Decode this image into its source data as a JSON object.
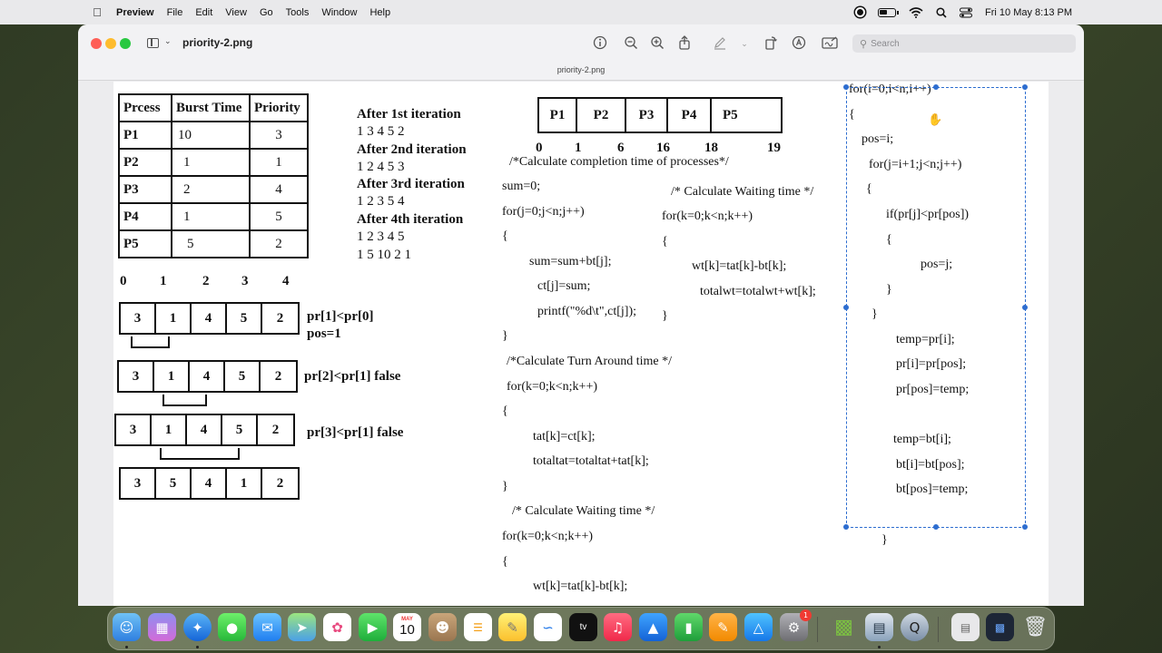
{
  "menubar": {
    "app_name": "Preview",
    "items": [
      "File",
      "Edit",
      "View",
      "Go",
      "Tools",
      "Window",
      "Help"
    ],
    "datetime": "Fri 10 May  8:13 PM"
  },
  "window": {
    "file_name": "priority-2.png",
    "subtitle": "priority-2.png",
    "search_placeholder": "Search"
  },
  "doc": {
    "table": {
      "headers": [
        "Prcess",
        "Burst Time",
        "Priority"
      ],
      "rows": [
        [
          "P1",
          "10",
          "3"
        ],
        [
          "P2",
          "1",
          "1"
        ],
        [
          "P3",
          "2",
          "4"
        ],
        [
          "P4",
          "1",
          "5"
        ],
        [
          "P5",
          "5",
          "2"
        ]
      ]
    },
    "iterations": [
      {
        "title": "After  1st iteration",
        "values": "1    3    4    5    2"
      },
      {
        "title": "After 2nd iteration",
        "values": "1    2    4    5    3"
      },
      {
        "title": "After 3rd iteration",
        "values": "1    2     3    5    4"
      },
      {
        "title": "After 4th iteration",
        "values": "1    2    3    4     5"
      }
    ],
    "iteration_final": "1    5    10   2    1",
    "gantt": {
      "cells": [
        "P1",
        "P2",
        "P3",
        "P4",
        "P5"
      ],
      "times": [
        "0",
        "1",
        "6",
        "16",
        "18",
        "19"
      ]
    },
    "index_labels": [
      "0",
      "1",
      "2",
      "3",
      "4"
    ],
    "arrays": [
      {
        "cells": [
          "3",
          "1",
          "4",
          "5",
          "2"
        ],
        "note": "pr[1]<pr[0]",
        "note2": "pos=1"
      },
      {
        "cells": [
          "3",
          "1",
          "4",
          "5",
          "2"
        ],
        "note": "pr[2]<pr[1] false"
      },
      {
        "cells": [
          "3",
          "1",
          "4",
          "5",
          "2"
        ],
        "note": "pr[3]<pr[1] false"
      },
      {
        "cells": [
          "3",
          "5",
          "4",
          "1",
          "2"
        ]
      }
    ],
    "code_mid": [
      "/*Calculate completion time of processes*/",
      "sum=0;",
      "for(j=0;j<n;j++)",
      "{",
      "sum=sum+bt[j];",
      "ct[j]=sum;",
      "printf(\"%d\\t\",ct[j]);",
      "}",
      "/*Calculate Turn Around time */",
      "for(k=0;k<n;k++)",
      "{",
      "tat[k]=ct[k];",
      "totaltat=totaltat+tat[k];",
      "}",
      "/*  Calculate Waiting time  */",
      "for(k=0;k<n;k++)",
      "{",
      "wt[k]=tat[k]-bt[k];"
    ],
    "code_wait": [
      "/*  Calculate Waiting time  */",
      "for(k=0;k<n;k++)",
      "{",
      "wt[k]=tat[k]-bt[k];",
      "totalwt=totalwt+wt[k];",
      "}"
    ],
    "code_right": [
      "for(i=0;i<n;i++)",
      "{",
      "pos=i;",
      "for(j=i+1;j<n;j++)",
      "{",
      "if(pr[j]<pr[pos])",
      "{",
      "pos=j;",
      "}",
      "}",
      "temp=pr[i];",
      "pr[i]=pr[pos];",
      "pr[pos]=temp;",
      "temp=bt[i];",
      "bt[i]=bt[pos];",
      "bt[pos]=temp;",
      "}"
    ]
  },
  "dock": {
    "calendar_month": "MAY",
    "calendar_day": "10",
    "system_settings_badge": "1",
    "tv_label": "tv"
  }
}
